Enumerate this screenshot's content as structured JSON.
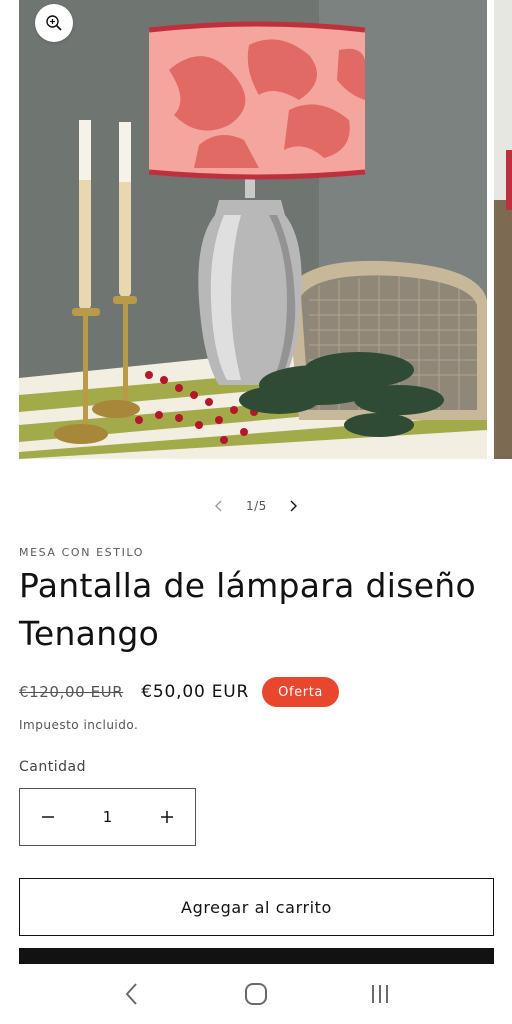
{
  "product": {
    "vendor": "MESA CON ESTILO",
    "title": "Pantalla de lámpara diseño Tenango",
    "price_regular": "€120,00 EUR",
    "price_sale": "€50,00 EUR",
    "badge": "Oferta",
    "tax_note": "Impuesto incluido."
  },
  "gallery": {
    "counter": "1/5",
    "image_alt": "Lámpara con pantalla rosa bordado Tenango sobre mesa con velas y ramas de pino"
  },
  "quantity": {
    "label": "Cantidad",
    "value": "1"
  },
  "actions": {
    "add_to_cart": "Agregar al carrito"
  },
  "icons": {
    "zoom": "zoom-in-icon",
    "prev": "chevron-left-icon",
    "next": "chevron-right-icon",
    "minus": "minus-icon",
    "plus": "plus-icon",
    "nav_back": "back-icon",
    "nav_home": "home-icon",
    "nav_recents": "recents-icon"
  },
  "colors": {
    "badge": "#e8472d",
    "text": "#121212",
    "lampshade": "#f0a09a"
  }
}
